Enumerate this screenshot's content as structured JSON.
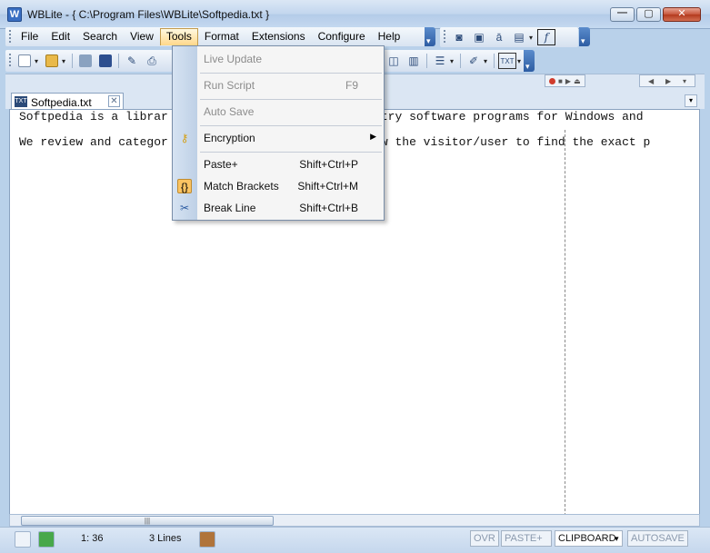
{
  "window": {
    "app_icon": "wblite-icon",
    "title": "WBLite - { C:\\Program Files\\WBLite\\Softpedia.txt }",
    "buttons": {
      "minimize": "minimize-icon",
      "maximize": "maximize-icon",
      "close": "close-icon"
    }
  },
  "menubar": {
    "items": [
      "File",
      "Edit",
      "Search",
      "View",
      "Tools",
      "Format",
      "Extensions",
      "Configure",
      "Help"
    ],
    "active": "Tools"
  },
  "toolbar_top_right": {
    "icons": [
      "camera-icon",
      "package-icon",
      "spellcheck-icon",
      "document-icon",
      "function-icon"
    ]
  },
  "toolbar_main": {
    "icons": [
      "new-file-icon",
      "open-folder-icon",
      "save-icon",
      "save-all-icon",
      "edit-tool-icon",
      "print-icon",
      "split-view-icon",
      "column-view-icon",
      "list-icon",
      "highlight-icon",
      "text-block-icon"
    ]
  },
  "tab": {
    "label": "Softpedia.txt",
    "icon": "text-file-icon",
    "close": "close-icon"
  },
  "editor": {
    "lines": [
      "Softpedia is a librar                        ee-to-try software programs for Windows and",
      "",
      "We review and categor                        o allow the visitor/user to find the exact p"
    ]
  },
  "tools_menu": {
    "items": [
      {
        "label": "Live Update",
        "shortcut": "",
        "disabled": true,
        "icon": ""
      },
      {
        "label": "Run Script",
        "shortcut": "F9",
        "disabled": true,
        "icon": ""
      },
      {
        "label": "Auto Save",
        "shortcut": "",
        "disabled": true,
        "icon": ""
      },
      {
        "label": "Encryption",
        "shortcut": "",
        "disabled": false,
        "icon": "key-icon",
        "submenu": true
      },
      {
        "label": "Paste+",
        "shortcut": "Shift+Ctrl+P",
        "disabled": false,
        "icon": ""
      },
      {
        "label": "Match Brackets",
        "shortcut": "Shift+Ctrl+M",
        "disabled": false,
        "icon": "braces-icon"
      },
      {
        "label": "Break Line",
        "shortcut": "Shift+Ctrl+B",
        "disabled": false,
        "icon": "scissors-icon"
      }
    ]
  },
  "statusbar": {
    "position": "1: 36",
    "lines": "3 Lines",
    "ovr": "OVR",
    "paste_mode": "PASTE+",
    "clipboard": "CLIPBOARD",
    "autosave": "AUTOSAVE"
  }
}
